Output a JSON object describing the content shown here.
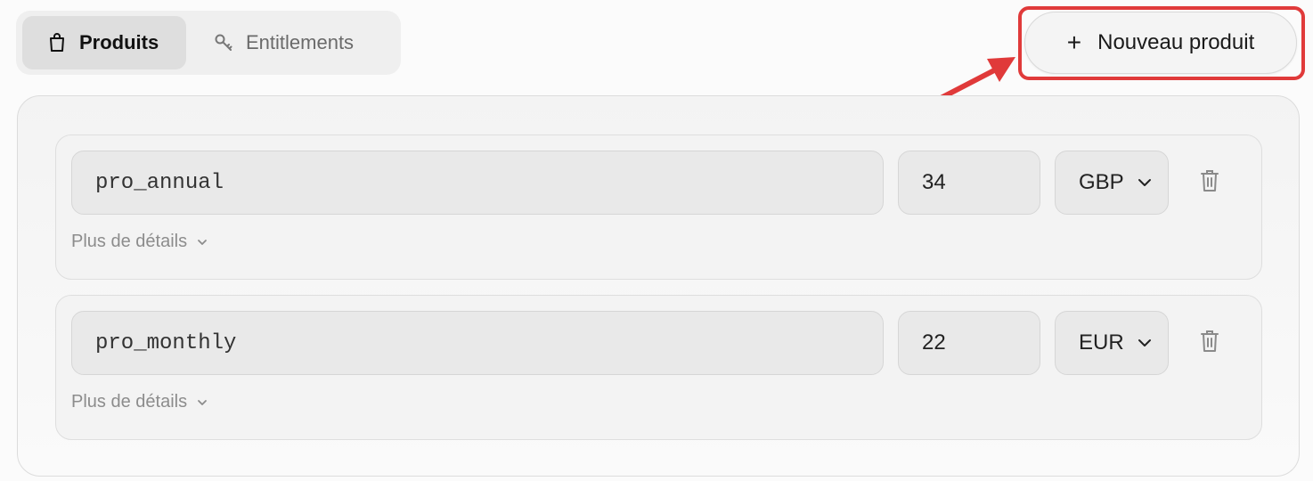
{
  "tabs": [
    {
      "label": "Produits",
      "icon": "bag-icon",
      "active": true
    },
    {
      "label": "Entitlements",
      "icon": "key-icon",
      "active": false
    }
  ],
  "new_product_button": {
    "label": "Nouveau produit",
    "icon": "plus-icon"
  },
  "annotation": {
    "color": "#e03a3a"
  },
  "products": [
    {
      "name": "pro_annual",
      "price": "34",
      "currency": "GBP",
      "details_label": "Plus de détails"
    },
    {
      "name": "pro_monthly",
      "price": "22",
      "currency": "EUR",
      "details_label": "Plus de détails"
    }
  ]
}
